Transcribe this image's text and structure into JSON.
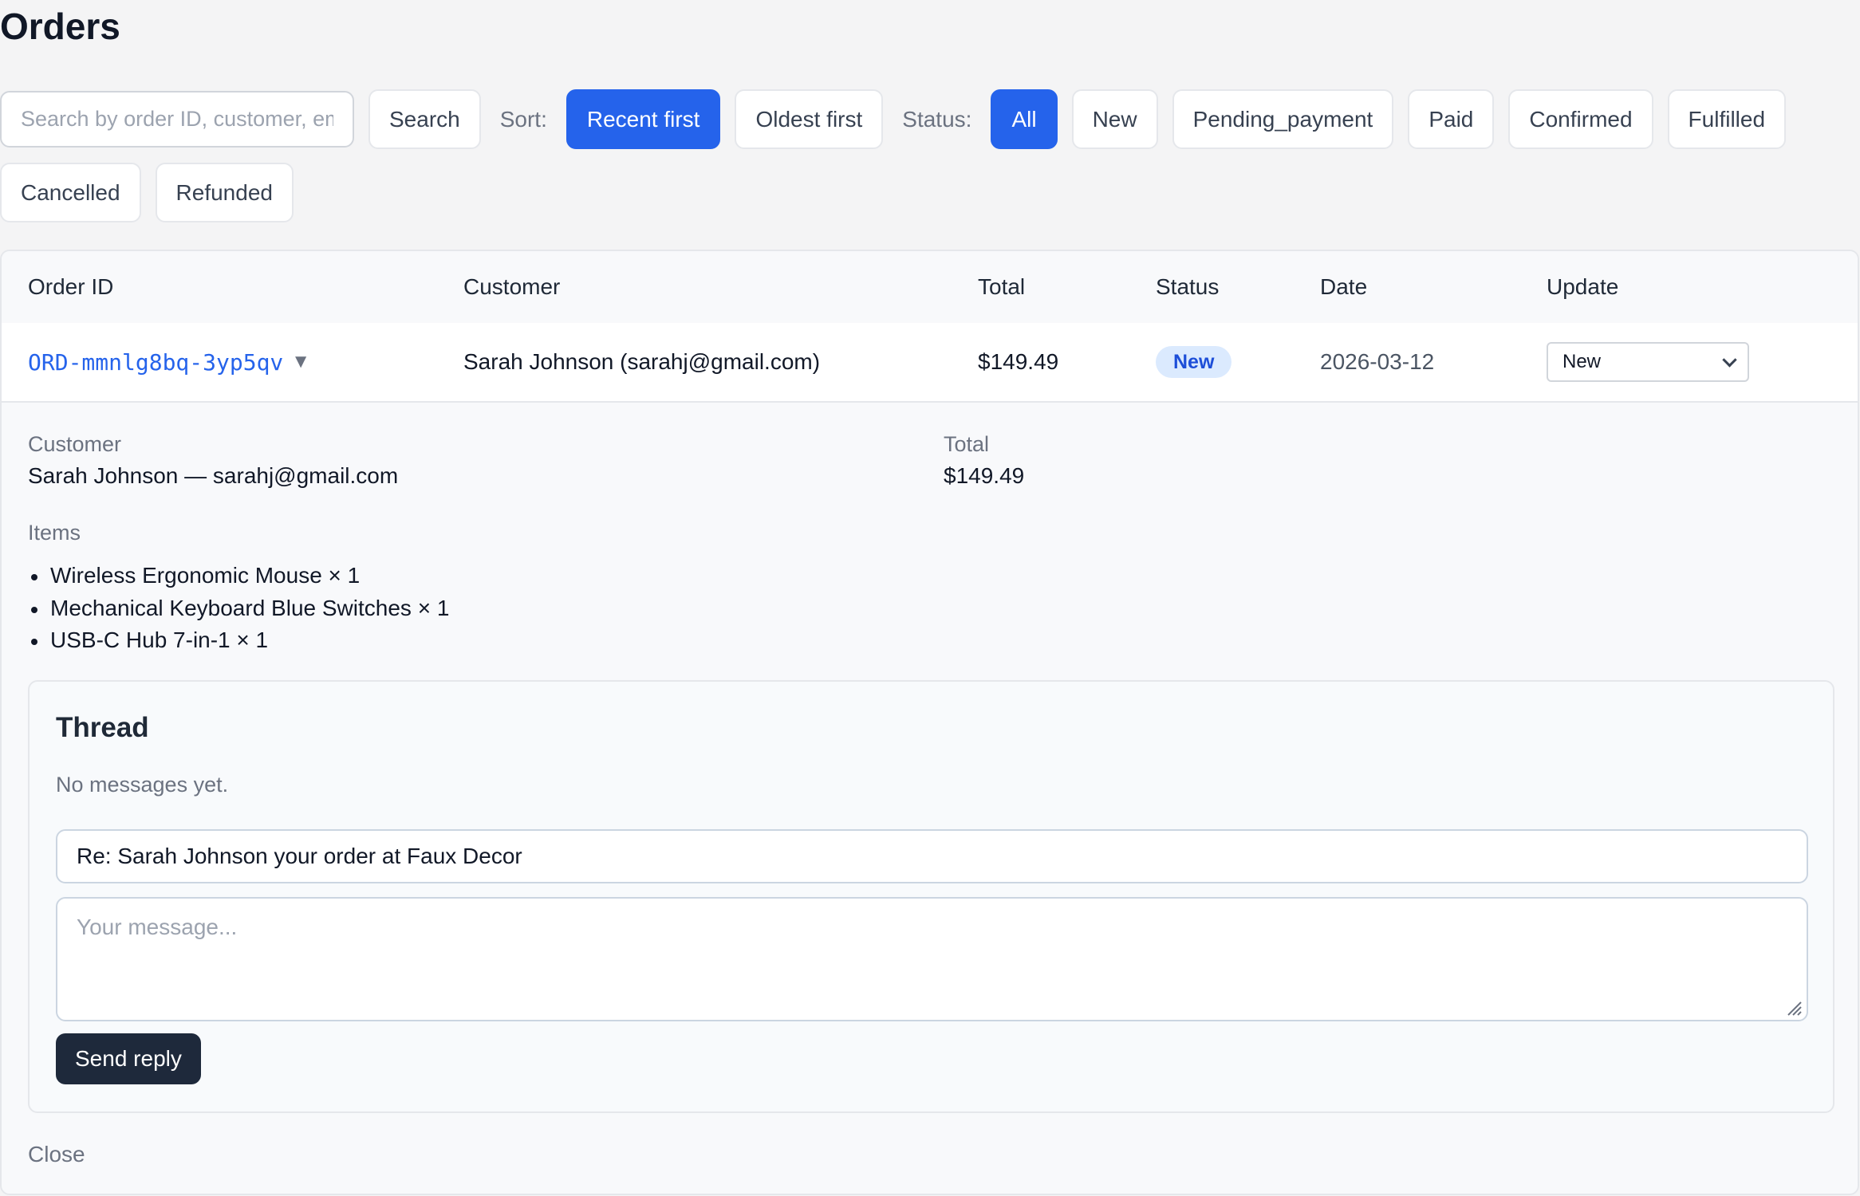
{
  "page": {
    "title": "Orders"
  },
  "toolbar": {
    "search_placeholder": "Search by order ID, customer, email",
    "search_label": "Search",
    "sort_label": "Sort:",
    "sort_options": [
      {
        "label": "Recent first",
        "active": true
      },
      {
        "label": "Oldest first",
        "active": false
      }
    ],
    "status_label": "Status:",
    "status_filters": [
      {
        "label": "All",
        "active": true
      },
      {
        "label": "New",
        "active": false
      },
      {
        "label": "Pending_payment",
        "active": false
      },
      {
        "label": "Paid",
        "active": false
      },
      {
        "label": "Confirmed",
        "active": false
      },
      {
        "label": "Fulfilled",
        "active": false
      },
      {
        "label": "Cancelled",
        "active": false
      },
      {
        "label": "Refunded",
        "active": false
      }
    ]
  },
  "table": {
    "headers": {
      "order_id": "Order ID",
      "customer": "Customer",
      "total": "Total",
      "status": "Status",
      "date": "Date",
      "update": "Update"
    },
    "rows": [
      {
        "order_id": "ORD-mmnlg8bq-3yp5qv",
        "expand_icon": "▼",
        "customer": "Sarah Johnson (sarahj@gmail.com)",
        "total": "$149.49",
        "status": "New",
        "date": "2026-03-12",
        "update_value": "New"
      }
    ]
  },
  "details": {
    "customer_label": "Customer",
    "customer_value": "Sarah Johnson — sarahj@gmail.com",
    "total_label": "Total",
    "total_value": "$149.49",
    "items_label": "Items",
    "items": [
      "Wireless Ergonomic Mouse × 1",
      "Mechanical Keyboard Blue Switches × 1",
      "USB-C Hub 7-in-1 × 1"
    ]
  },
  "thread": {
    "title": "Thread",
    "empty_text": "No messages yet.",
    "subject_value": "Re: Sarah Johnson your order at Faux Decor",
    "message_placeholder": "Your message...",
    "send_label": "Send reply"
  },
  "close_label": "Close",
  "colors": {
    "accent": "#2563eb",
    "badge_bg": "#dbeafe",
    "badge_text": "#1d4ed8",
    "dark_button": "#1e293b",
    "page_bg": "#f4f4f5"
  }
}
